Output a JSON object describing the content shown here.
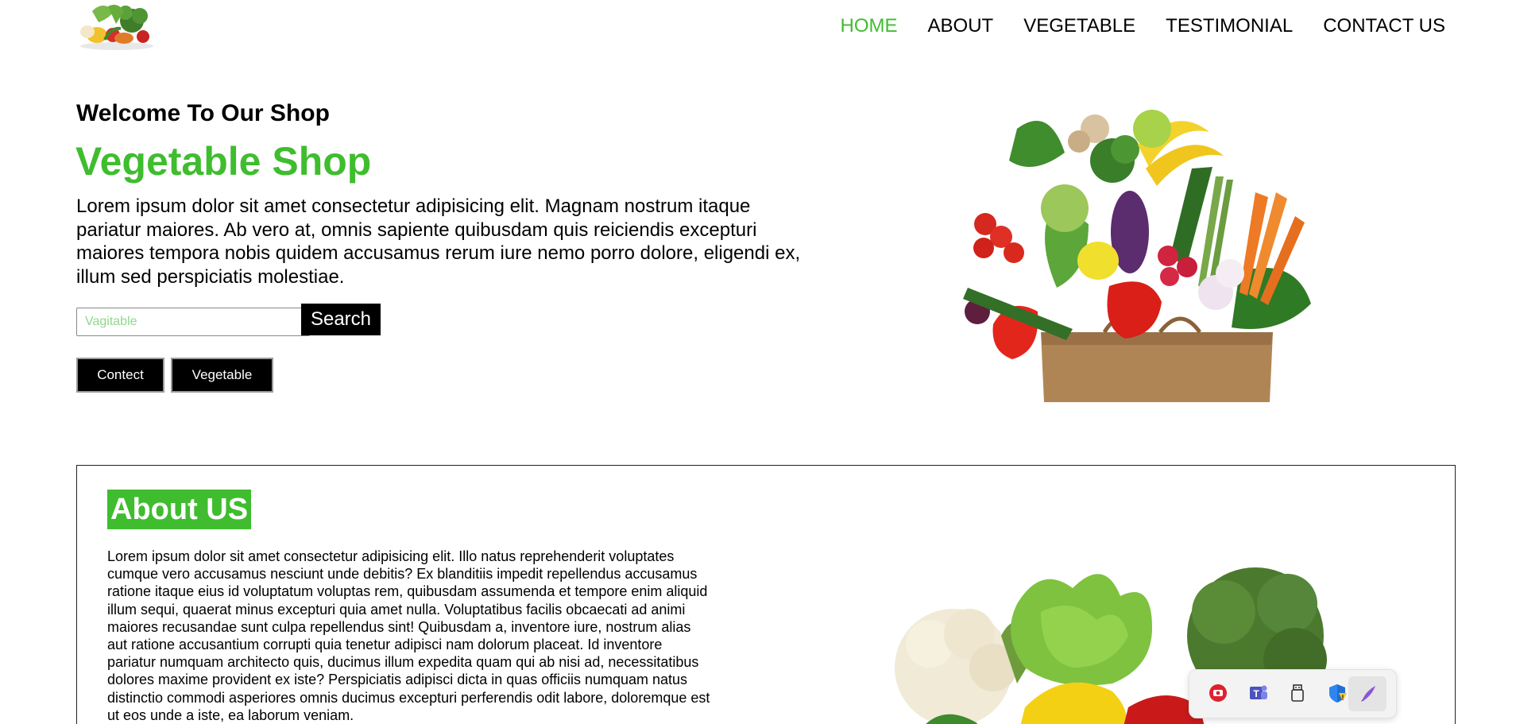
{
  "nav": {
    "items": [
      {
        "label": "HOME",
        "active": true
      },
      {
        "label": "ABOUT",
        "active": false
      },
      {
        "label": "VEGETABLE",
        "active": false
      },
      {
        "label": "TESTIMONIAL",
        "active": false
      },
      {
        "label": "CONTACT US",
        "active": false
      }
    ]
  },
  "hero": {
    "welcome": "Welcome To Our Shop",
    "title": "Vegetable Shop",
    "intro": "Lorem ipsum dolor sit amet consectetur adipisicing elit. Magnam nostrum itaque pariatur maiores. Ab vero at, omnis sapiente quibusdam quis reiciendis excepturi maiores tempora nobis quidem accusamus rerum iure nemo porro dolore, eligendi ex, illum sed perspiciatis molestiae.",
    "search_placeholder": "Vagitable",
    "search_value": "",
    "search_label": "Search",
    "contect_label": "Contect",
    "vegetable_label": "Vegetable"
  },
  "about": {
    "title": "About US",
    "text": "Lorem ipsum dolor sit amet consectetur adipisicing elit. Illo natus reprehenderit voluptates cumque vero accusamus nesciunt unde debitis? Ex blanditiis impedit repellendus accusamus ratione itaque eius id voluptatum voluptas rem, quibusdam assumenda et tempore enim aliquid illum sequi, quaerat minus excepturi quia amet nulla. Voluptatibus facilis obcaecati ad animi maiores recusandae sunt culpa repellendus sint! Quibusdam a, inventore iure, nostrum alias aut ratione accusantium corrupti quia tenetur adipisci nam dolorum placeat. Id inventore pariatur numquam architecto quis, ducimus illum expedita quam qui ab nisi ad, necessitatibus dolores maxime provident ex iste? Perspiciatis adipisci dicta in quas officiis numquam natus distinctio commodi asperiores omnis ducimus excepturi perferendis odit labore, doloremque est ut eos unde a iste, ea laborum veniam."
  },
  "colors": {
    "accent": "#3fbd2f",
    "button_bg": "#000000"
  },
  "tray": {
    "icons": [
      "record-icon",
      "teams-icon",
      "usb-drive-icon",
      "security-shield-icon",
      "pen-icon"
    ]
  }
}
